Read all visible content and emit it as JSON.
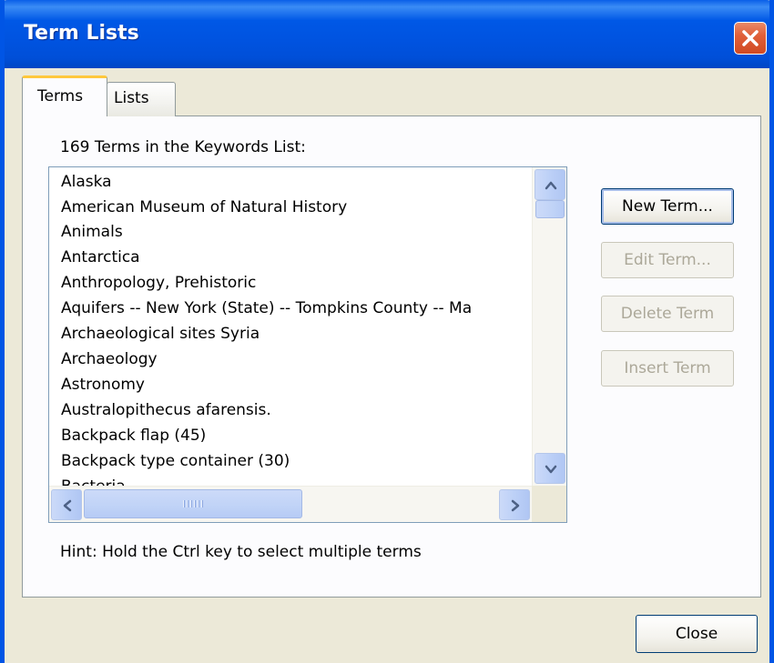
{
  "window": {
    "title": "Term Lists"
  },
  "tabs": [
    {
      "label": "Terms",
      "selected": true
    },
    {
      "label": "Lists",
      "selected": false
    }
  ],
  "terms_panel": {
    "count_label": "169 Terms in the Keywords List:",
    "terms": [
      "Alaska",
      "American Museum of Natural History",
      "Animals",
      "Antarctica",
      "Anthropology, Prehistoric",
      "Aquifers -- New York (State) -- Tompkins County -- Ma",
      "Archaeological sites Syria",
      "Archaeology",
      "Astronomy",
      "Australopithecus afarensis.",
      "Backpack flap (45)",
      "Backpack type container (30)",
      "Bacteria"
    ],
    "buttons": {
      "new_term": "New Term...",
      "edit_term": "Edit Term...",
      "delete_term": "Delete Term",
      "insert_term": "Insert Term"
    },
    "hint": "Hint: Hold the Ctrl key to select multiple terms"
  },
  "footer": {
    "close_label": "Close"
  },
  "colors": {
    "titlebar": "#0054e3",
    "dialog_bg": "#ece9d8",
    "close_button": "#e0603a",
    "selected_tab_highlight": "#ffc83c",
    "disabled_text": "#aca899"
  },
  "icons": {
    "close": "close-x-icon",
    "scroll_up": "scroll-up-arrow-icon",
    "scroll_down": "scroll-down-arrow-icon",
    "scroll_left": "scroll-left-arrow-icon",
    "scroll_right": "scroll-right-arrow-icon"
  }
}
